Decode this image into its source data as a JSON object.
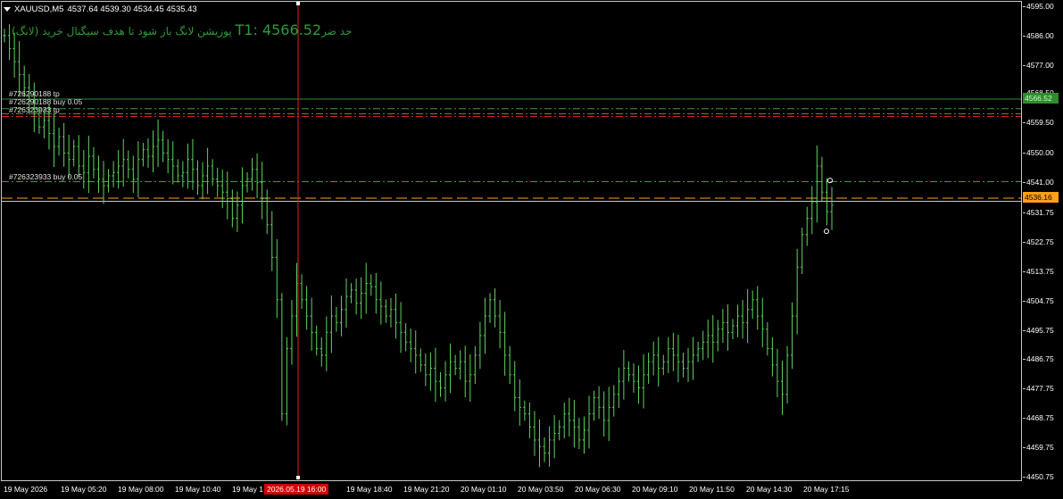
{
  "window": {
    "symbol": "XAUUSD,M5",
    "ohlc": "4537.64 4539.30 4534.45 4535.43"
  },
  "signal": {
    "prefix": "حد ضر",
    "target": "T1: 4566.52",
    "text": "پوزیشن لانگ باز شود تا هدف سیگنال خرید (لانگ)"
  },
  "orders": [
    {
      "label": "#726290188 tp",
      "price": 4563.6,
      "color": "#3c9a3c",
      "style": "dashdot"
    },
    {
      "label": "#726290188 buy 0.05",
      "price": 4562.0,
      "color": "#3c9a3c",
      "style": "dashdot"
    },
    {
      "label": "#726323933 tp",
      "price": 4561.2,
      "color": "#e02020",
      "style": "dashdot"
    },
    {
      "label": "#726323933 buy 0.05",
      "price": 4541.2,
      "color": "#3c9a3c",
      "style": "dashdot"
    }
  ],
  "levels": {
    "signal_tp": {
      "price": 4566.52,
      "label": "4566.52",
      "color": "#2e8b2e"
    },
    "bid": {
      "price": 4536.16,
      "label": "4536.16",
      "color": "#ff9f1a"
    },
    "ask": {
      "price": 4535.2,
      "color": "#c8c8c8"
    }
  },
  "axis": {
    "y_labels": [
      "4595.00",
      "4586.00",
      "4577.00",
      "4568.50",
      "4559.50",
      "4550.00",
      "4541.00",
      "4531.75",
      "4522.75",
      "4513.75",
      "4504.75",
      "4495.75",
      "4486.75",
      "4477.75",
      "4468.75",
      "4459.75",
      "4450.75"
    ],
    "x_labels": [
      "19 May 2026",
      "19 May 05:20",
      "19 May 08:00",
      "19 May 10:40",
      "19 May 1",
      "19 May 18:40",
      "19 May 21:20",
      "20 May 01:10",
      "20 May 03:50",
      "20 May 06:30",
      "20 May 09:10",
      "20 May 11:50",
      "20 May 14:30",
      "20 May 17:15"
    ],
    "cursor_time": "2026.05.19 16:00"
  },
  "chart_data": {
    "type": "bar",
    "symbol": "XAUUSD",
    "timeframe": "M5",
    "ylim": [
      4450.75,
      4595.0
    ],
    "cursor_price_line": 4566.52,
    "series": [
      {
        "ohlc_closes": [
          4586,
          4582,
          4578,
          4574,
          4570,
          4566,
          4562,
          4558,
          4560,
          4556,
          4552,
          4555,
          4550,
          4548,
          4552,
          4546,
          4544,
          4549,
          4545,
          4542,
          4540,
          4543,
          4544,
          4546,
          4548,
          4545,
          4542,
          4548,
          4551,
          4549,
          4552,
          4554,
          4550,
          4548,
          4546,
          4543,
          4544,
          4548,
          4545,
          4540,
          4543,
          4546,
          4542,
          4540,
          4538,
          4536,
          4530,
          4534,
          4540,
          4542,
          4545,
          4541,
          4536,
          4528,
          4518,
          4505,
          4470,
          4490,
          4500,
          4510,
          4505,
          4500,
          4495,
          4490,
          4488,
          4495,
          4500,
          4498,
          4502,
          4506,
          4508,
          4504,
          4507,
          4510,
          4509,
          4505,
          4503,
          4500,
          4502,
          4498,
          4495,
          4492,
          4490,
          4488,
          4485,
          4482,
          4484,
          4480,
          4478,
          4482,
          4486,
          4484,
          4486,
          4480,
          4482,
          4488,
          4494,
          4500,
          4505,
          4500,
          4495,
          4488,
          4482,
          4475,
          4472,
          4470,
          4466,
          4462,
          4460,
          4458,
          4462,
          4464,
          4466,
          4470,
          4468,
          4466,
          4462,
          4465,
          4470,
          4475,
          4472,
          4468,
          4472,
          4476,
          4480,
          4484,
          4482,
          4480,
          4478,
          4482,
          4486,
          4488,
          4484,
          4486,
          4490,
          4488,
          4486,
          4484,
          4486,
          4488,
          4490,
          4492,
          4494,
          4492,
          4496,
          4498,
          4495,
          4497,
          4500,
          4498,
          4502,
          4505,
          4500,
          4496,
          4490,
          4485,
          4480,
          4476,
          4488,
          4500,
          4515,
          4525,
          4530,
          4535,
          4546,
          4538,
          4532,
          4534
        ]
      }
    ]
  }
}
